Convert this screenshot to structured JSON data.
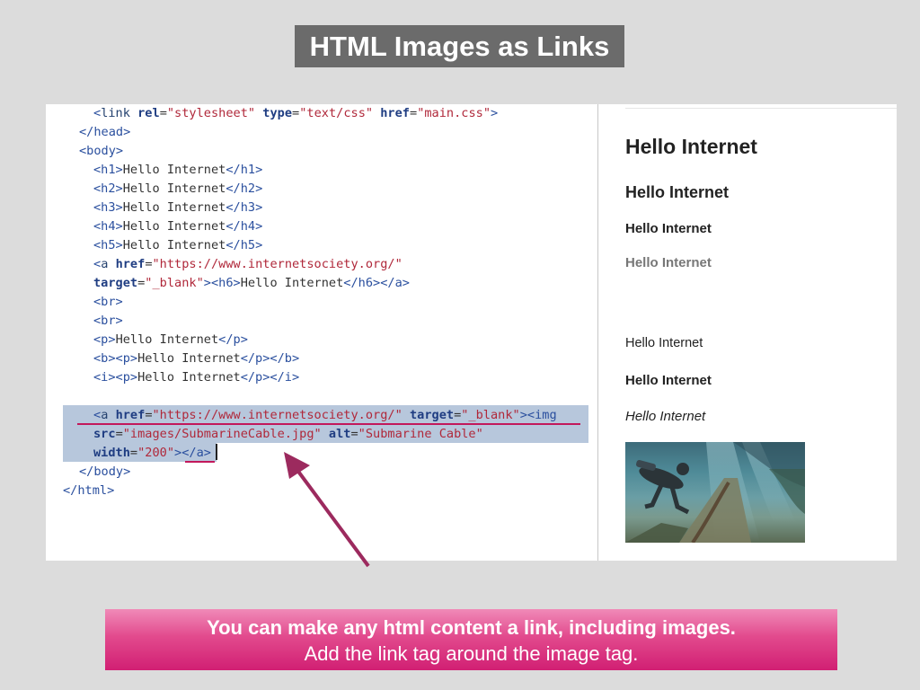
{
  "slide": {
    "title": "HTML Images as Links",
    "caption_line1": "You can make any html content a link, including images.",
    "caption_line2": "Add the link tag around the image tag."
  },
  "code": {
    "l1": {
      "lt1": "<",
      "tag": "link",
      "sp1": " ",
      "a1": "rel",
      "eq1": "=",
      "v1": "\"stylesheet\"",
      "sp2": " ",
      "a2": "type",
      "eq2": "=",
      "v2": "\"text/css\"",
      "sp3": " ",
      "a3": "href",
      "eq3": "=",
      "v3": "\"main.css\"",
      "gt": ">"
    },
    "l2": "</head>",
    "l3": "<body>",
    "l4": {
      "open": "<h1>",
      "text": "Hello Internet",
      "close": "</h1>"
    },
    "l5": {
      "open": "<h2>",
      "text": "Hello Internet",
      "close": "</h2>"
    },
    "l6": {
      "open": "<h3>",
      "text": "Hello Internet",
      "close": "</h3>"
    },
    "l7": {
      "open": "<h4>",
      "text": "Hello Internet",
      "close": "</h4>"
    },
    "l8": {
      "open": "<h5>",
      "text": "Hello Internet",
      "close": "</h5>"
    },
    "l9": {
      "lt": "<",
      "tag": "a",
      "sp": " ",
      "attr": "href",
      "eq": "=",
      "val": "\"https://www.internetsociety.org/\""
    },
    "l10": {
      "attr": "target",
      "eq": "=",
      "val": "\"_blank\"",
      "open": "><h6>",
      "text": "Hello Internet",
      "close": "</h6></a>"
    },
    "l11": "<br>",
    "l12": "<br>",
    "l13": {
      "open": "<p>",
      "text": "Hello Internet",
      "close": "</p>"
    },
    "l14": {
      "open": "<b><p>",
      "text": "Hello Internet",
      "close": "</p></b>"
    },
    "l15": {
      "open": "<i><p>",
      "text": "Hello Internet",
      "close": "</p></i>"
    },
    "l17": {
      "lt": "<",
      "tag": "a",
      "sp": " ",
      "attr1": "href",
      "eq1": "=",
      "val1": "\"https://www.internetsociety.org/\"",
      "sp2": " ",
      "attr2": "target",
      "eq2": "=",
      "val2": "\"_blank\"",
      "img": "><img"
    },
    "l18": {
      "attr1": "src",
      "eq1": "=",
      "val1": "\"images/SubmarineCable.jpg\"",
      "sp": " ",
      "attr2": "alt",
      "eq2": "=",
      "val2": "\"Submarine Cable\""
    },
    "l19": {
      "attr": "width",
      "eq": "=",
      "val": "\"200\"",
      "close": "></a>"
    },
    "l20": "</body>",
    "l21": "</html>"
  },
  "preview": {
    "h1": "Hello Internet",
    "h2": "Hello Internet",
    "h3": "Hello Internet",
    "h6_link": "Hello Internet",
    "p": "Hello Internet",
    "b": "Hello Internet",
    "i": "Hello Internet",
    "image_icon": "submarine-cable-photo"
  },
  "colors": {
    "accent": "#c2185b",
    "arrow": "#9c2a5e",
    "title_bg": "#6b6b6b"
  }
}
